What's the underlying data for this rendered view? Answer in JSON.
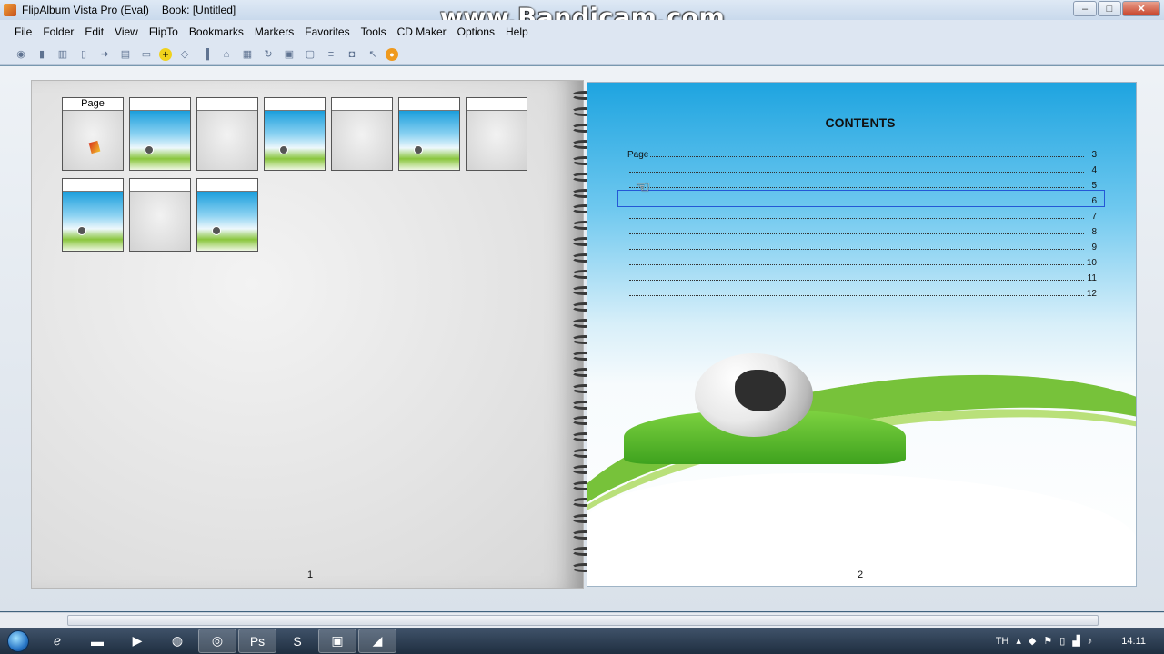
{
  "window": {
    "title": "FlipAlbum Vista Pro (Eval)",
    "book": "Book: [Untitled]",
    "minimize": "–",
    "maximize": "□",
    "close": "✕"
  },
  "watermark": "www.Bandicam.com",
  "menu": [
    "File",
    "Folder",
    "Edit",
    "View",
    "FlipTo",
    "Bookmarks",
    "Markers",
    "Favorites",
    "Tools",
    "CD Maker",
    "Options",
    "Help"
  ],
  "toolbar_icons": [
    "eye-icon",
    "page-icon",
    "book-icon",
    "doc-icon",
    "arrow-icon",
    "pages-icon",
    "print-icon",
    "add-icon",
    "diamond-icon",
    "columns-icon",
    "tag-icon",
    "album-icon",
    "rotate-icon",
    "frame-icon",
    "slide-icon",
    "list-icon",
    "camera-icon",
    "pointer-icon",
    "burn-icon"
  ],
  "left_page": {
    "thumbs": [
      {
        "kind": "gray",
        "caption": "Page",
        "marker": true
      },
      {
        "kind": "sky",
        "caption": ""
      },
      {
        "kind": "gray",
        "caption": ""
      },
      {
        "kind": "sky",
        "caption": ""
      },
      {
        "kind": "gray",
        "caption": ""
      },
      {
        "kind": "sky",
        "caption": ""
      },
      {
        "kind": "gray",
        "caption": ""
      },
      {
        "kind": "sky",
        "caption": ""
      },
      {
        "kind": "gray",
        "caption": ""
      },
      {
        "kind": "sky",
        "caption": ""
      }
    ],
    "page_number": "1"
  },
  "right_page": {
    "title": "CONTENTS",
    "toc": [
      {
        "label": "Page",
        "num": "3"
      },
      {
        "label": "",
        "num": "4"
      },
      {
        "label": "",
        "num": "5"
      },
      {
        "label": "",
        "num": "6",
        "selected": true
      },
      {
        "label": "",
        "num": "7"
      },
      {
        "label": "",
        "num": "8"
      },
      {
        "label": "",
        "num": "9"
      },
      {
        "label": "",
        "num": "10"
      },
      {
        "label": "",
        "num": "11"
      },
      {
        "label": "",
        "num": "12"
      }
    ],
    "page_number": "2"
  },
  "taskbar": {
    "apps": [
      "ie-icon",
      "explorer-icon",
      "media-player-icon",
      "firefox-icon",
      "chrome-icon",
      "photoshop-icon",
      "skype-icon",
      "remote-icon",
      "flipalbum-icon"
    ],
    "language": "TH",
    "time": "14:11"
  }
}
